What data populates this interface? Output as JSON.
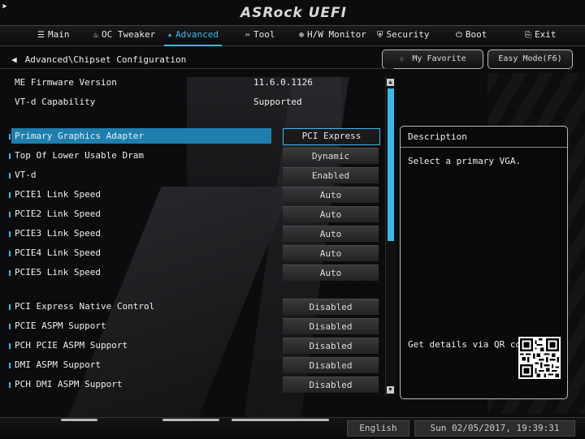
{
  "header": {
    "logo": "ASRock UEFI"
  },
  "tabs": [
    {
      "icon": "list-icon",
      "glyph": "☰",
      "label": "Main"
    },
    {
      "icon": "flame-icon",
      "glyph": "♨",
      "label": "OC Tweaker"
    },
    {
      "icon": "star-icon",
      "glyph": "★",
      "label": "Advanced"
    },
    {
      "icon": "tool-icon",
      "glyph": "✂",
      "label": "Tool"
    },
    {
      "icon": "monitor-icon",
      "glyph": "⊕",
      "label": "H/W Monitor"
    },
    {
      "icon": "shield-icon",
      "glyph": "⛨",
      "label": "Security"
    },
    {
      "icon": "power-icon",
      "glyph": "⏻",
      "label": "Boot"
    },
    {
      "icon": "exit-icon",
      "glyph": "⎘",
      "label": "Exit"
    }
  ],
  "breadcrumb": "Advanced\\Chipset Configuration",
  "buttons": {
    "favorite": "My Favorite",
    "easy_mode": "Easy Mode(F6)"
  },
  "info": [
    {
      "label": "ME Firmware Version",
      "value": "11.6.0.1126"
    },
    {
      "label": "VT-d Capability",
      "value": "Supported"
    }
  ],
  "settings_group1": [
    {
      "label": "Primary Graphics Adapter",
      "value": "PCI Express"
    },
    {
      "label": "Top Of Lower Usable Dram",
      "value": "Dynamic"
    },
    {
      "label": "VT-d",
      "value": "Enabled"
    },
    {
      "label": "PCIE1 Link Speed",
      "value": "Auto"
    },
    {
      "label": "PCIE2 Link Speed",
      "value": "Auto"
    },
    {
      "label": "PCIE3 Link Speed",
      "value": "Auto"
    },
    {
      "label": "PCIE4 Link Speed",
      "value": "Auto"
    },
    {
      "label": "PCIE5 Link Speed",
      "value": "Auto"
    }
  ],
  "settings_group2": [
    {
      "label": "PCI Express Native Control",
      "value": "Disabled"
    },
    {
      "label": "PCIE ASPM Support",
      "value": "Disabled"
    },
    {
      "label": "PCH PCIE ASPM Support",
      "value": "Disabled"
    },
    {
      "label": "DMI ASPM Support",
      "value": "Disabled"
    },
    {
      "label": "PCH DMI ASPM Support",
      "value": "Disabled"
    }
  ],
  "description": {
    "title": "Description",
    "text": "Select a primary VGA.",
    "qr_text": "Get details via QR code"
  },
  "footer": {
    "language": "English",
    "datetime": "Sun 02/05/2017, 19:39:31"
  },
  "colors": {
    "accent": "#3fb8e8",
    "selected_row": "#1e7fae"
  }
}
